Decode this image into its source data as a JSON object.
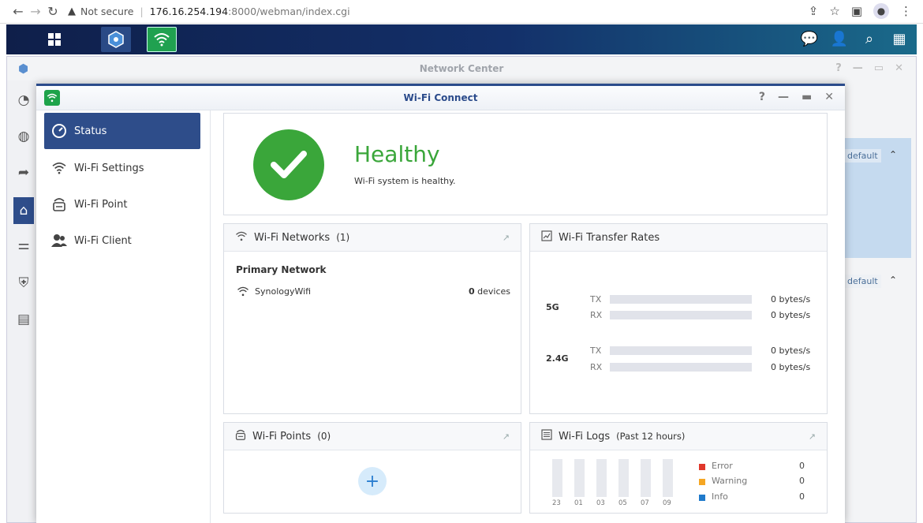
{
  "browser": {
    "security_label": "Not secure",
    "url_host": "176.16.254.194",
    "url_path": ":8000/webman/index.cgi"
  },
  "network_center": {
    "title": "Network Center",
    "default_label_1": "default",
    "default_label_2": "default"
  },
  "wifi_window": {
    "title": "Wi-Fi Connect",
    "sidebar": [
      {
        "label": "Status",
        "icon": "gauge-icon",
        "active": true
      },
      {
        "label": "Wi-Fi Settings",
        "icon": "wifi-icon",
        "active": false
      },
      {
        "label": "Wi-Fi Point",
        "icon": "router-icon",
        "active": false
      },
      {
        "label": "Wi-Fi Client",
        "icon": "users-icon",
        "active": false
      }
    ],
    "health": {
      "title": "Healthy",
      "message": "Wi-Fi system is healthy.",
      "color": "#3aa63a"
    },
    "networks": {
      "title": "Wi-Fi Networks",
      "count": "(1)",
      "group_label": "Primary Network",
      "ssid": "SynologyWifi",
      "device_count": "0",
      "device_label": "devices"
    },
    "transfer": {
      "title": "Wi-Fi Transfer Rates",
      "bands": [
        {
          "name": "5G",
          "tx_label": "TX",
          "rx_label": "RX",
          "tx": "0 bytes/s",
          "rx": "0 bytes/s"
        },
        {
          "name": "2.4G",
          "tx_label": "TX",
          "rx_label": "RX",
          "tx": "0 bytes/s",
          "rx": "0 bytes/s"
        }
      ]
    },
    "points": {
      "title": "Wi-Fi Points",
      "count": "(0)"
    },
    "logs": {
      "title": "Wi-Fi Logs",
      "subtitle": "(Past 12 hours)",
      "x_labels": [
        "23",
        "01",
        "03",
        "05",
        "07",
        "09"
      ],
      "legend": [
        {
          "label": "Error",
          "value": "0",
          "color": "#e0372b"
        },
        {
          "label": "Warning",
          "value": "0",
          "color": "#f5a623"
        },
        {
          "label": "Info",
          "value": "0",
          "color": "#1f7acb"
        }
      ]
    }
  }
}
